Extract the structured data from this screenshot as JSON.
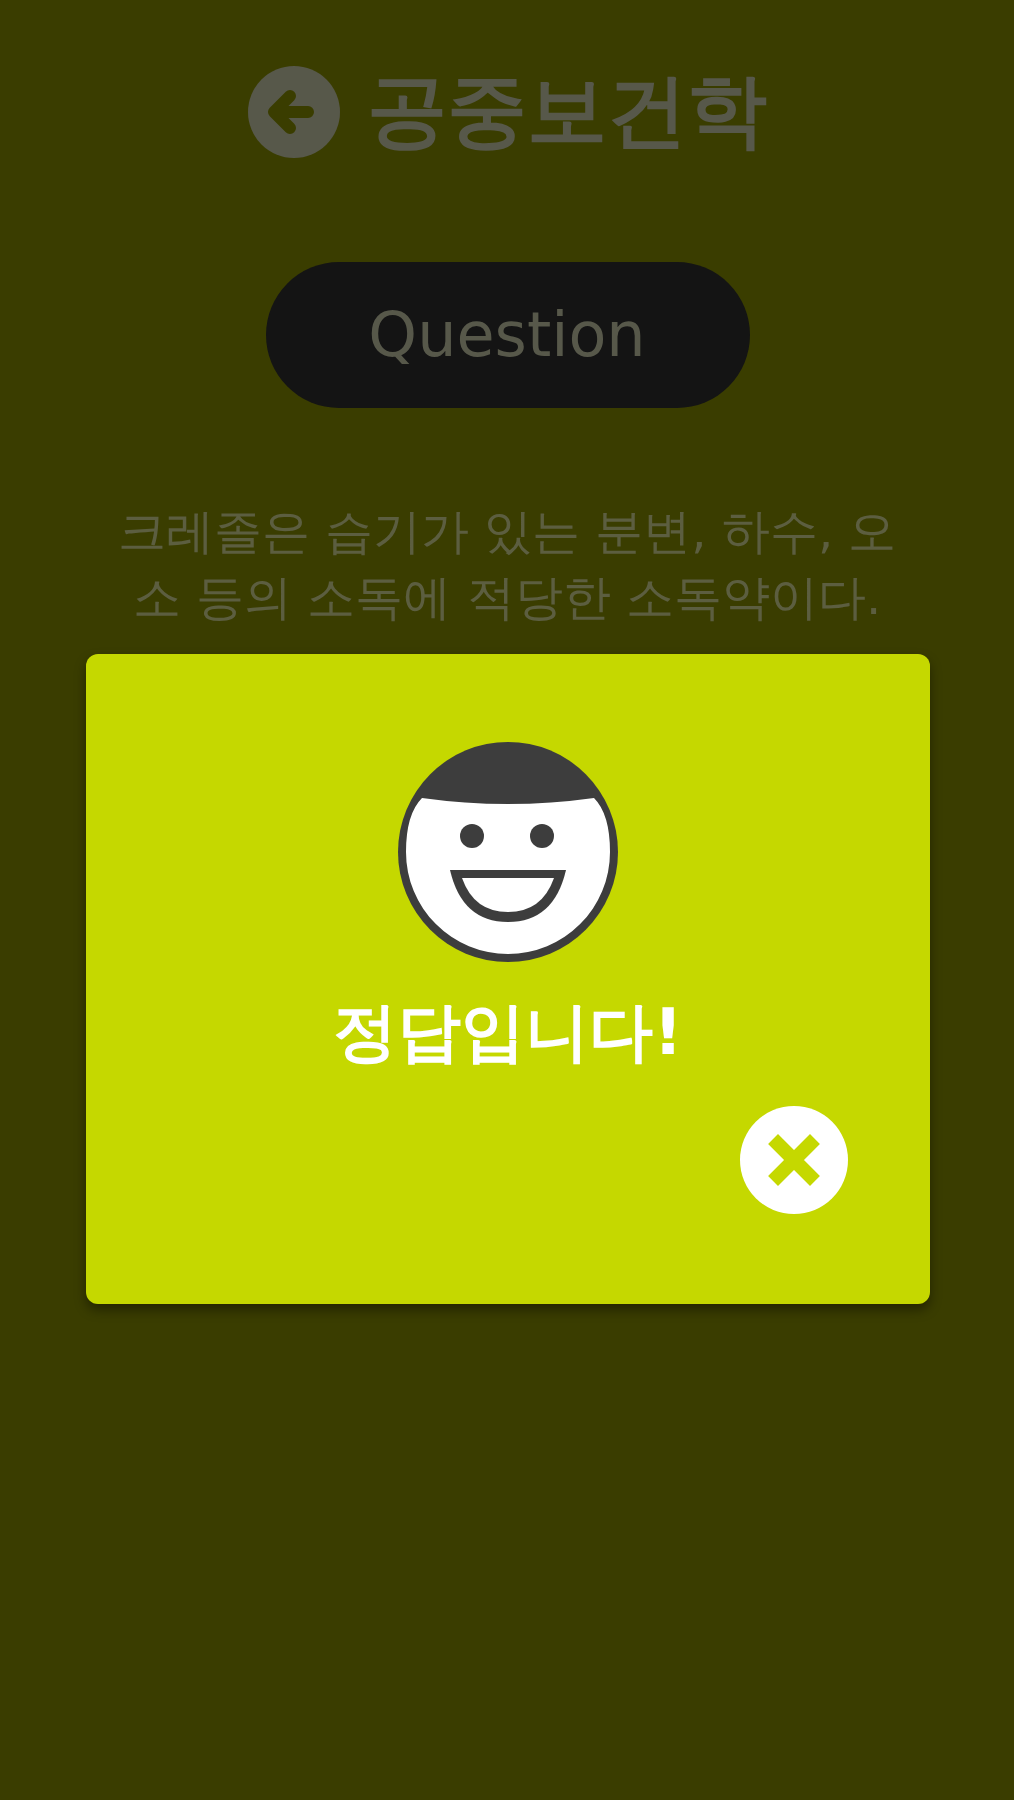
{
  "header": {
    "title": "공중보건학"
  },
  "question_button": {
    "label": "Question"
  },
  "question": {
    "lines": [
      "크레졸은 습기가 있는 분변, 하수, 오",
      "소 등의 소독에 적당한 소독약이다."
    ]
  },
  "dialog": {
    "message": "정답입니다!"
  }
}
